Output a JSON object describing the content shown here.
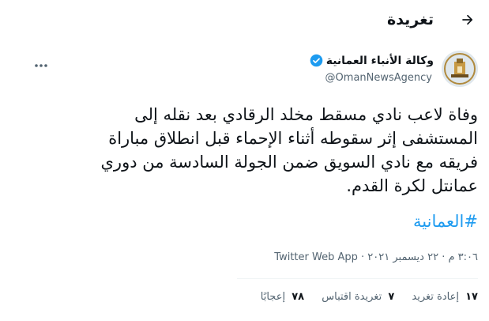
{
  "header": {
    "title": "تغريدة"
  },
  "author": {
    "name": "وكالة الأنباء العمانية",
    "handle": "@OmanNewsAgency",
    "verified_color": "#1d9bf0"
  },
  "tweet": {
    "lines": [
      "وفاة لاعب نادي مسقط مخلد الرقادي بعد نقله إلى",
      "المستشفى إثر سقوطه أثناء الإحماء قبل انطلاق مباراة",
      "فريقه مع نادي السويق ضمن الجولة السادسة من دوري",
      "عمانتل لكرة القدم."
    ],
    "hashtag": "#العمانية",
    "hashtag_color": "#1d9bf0"
  },
  "meta": {
    "time": "٣:٠٦ م",
    "date": "٢٢ ديسمبر ٢٠٢١",
    "source": "Twitter Web App"
  },
  "stats": {
    "retweets": {
      "count": "١٧",
      "label": "إعادة تغريد"
    },
    "quotes": {
      "count": "٧",
      "label": "تغريدة اقتباس"
    },
    "likes": {
      "count": "٧٨",
      "label": "إعجابًا"
    }
  }
}
